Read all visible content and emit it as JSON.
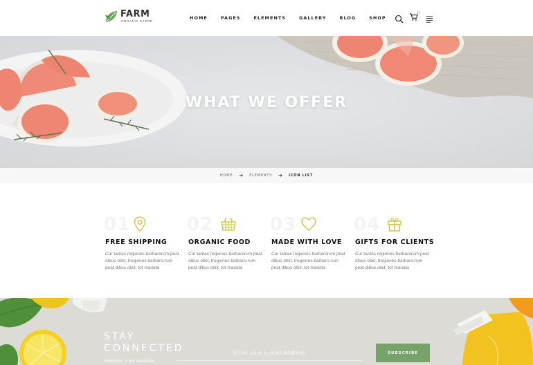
{
  "brand": {
    "name": "FARM",
    "tagline": "ORGANIC STORE"
  },
  "nav": [
    {
      "label": "HOME"
    },
    {
      "label": "PAGES"
    },
    {
      "label": "ELEMENTS"
    },
    {
      "label": "GALLERY"
    },
    {
      "label": "BLOG"
    },
    {
      "label": "SHOP"
    }
  ],
  "header": {
    "cart_count": "0"
  },
  "hero": {
    "title": "WHAT WE OFFER"
  },
  "breadcrumb": [
    {
      "label": "HOME"
    },
    {
      "label": "ELEMENTS"
    },
    {
      "label": "ICON LIST"
    }
  ],
  "features": [
    {
      "number": "01",
      "title": "FREE SHIPPING",
      "icon": "map-pin-icon",
      "text": "Cur tantas regiones barbarorum peat dibus obiit, tregiones barbaro-rum peat dibus obiit, tot mariata"
    },
    {
      "number": "02",
      "title": "ORGANIC FOOD",
      "icon": "basket-icon",
      "text": "Cur tantas regiones barbarorum peat dibus obiit, tregiones barbaro-rum peat dibus obiit, tot mariata"
    },
    {
      "number": "03",
      "title": "MADE WITH LOVE",
      "icon": "heart-icon",
      "text": "Cur tantas regiones barbarorum peat dibus obiit, tregiones barbaro-rum peat dibus obiit, tot mariata"
    },
    {
      "number": "04",
      "title": "GIFTS FOR CLIENTS",
      "icon": "gift-icon",
      "text": "Cur tantas regiones barbarorum peat dibus obiit, tregiones barbaro-rum peat dibus obiit, tot mariata"
    }
  ],
  "newsletter": {
    "title_line1": "STAY",
    "title_line2": "CONNECTED",
    "note": "Subscribe to our newsletter",
    "email_placeholder": "Enter your e-mail address",
    "button_label": "SUBSCRIBE"
  },
  "colors": {
    "accent": "#77a26a",
    "icon_yellow": "#c9bf3a",
    "hero_bg": "#dfe0e4",
    "newsletter_bg": "#dcdbd5"
  }
}
